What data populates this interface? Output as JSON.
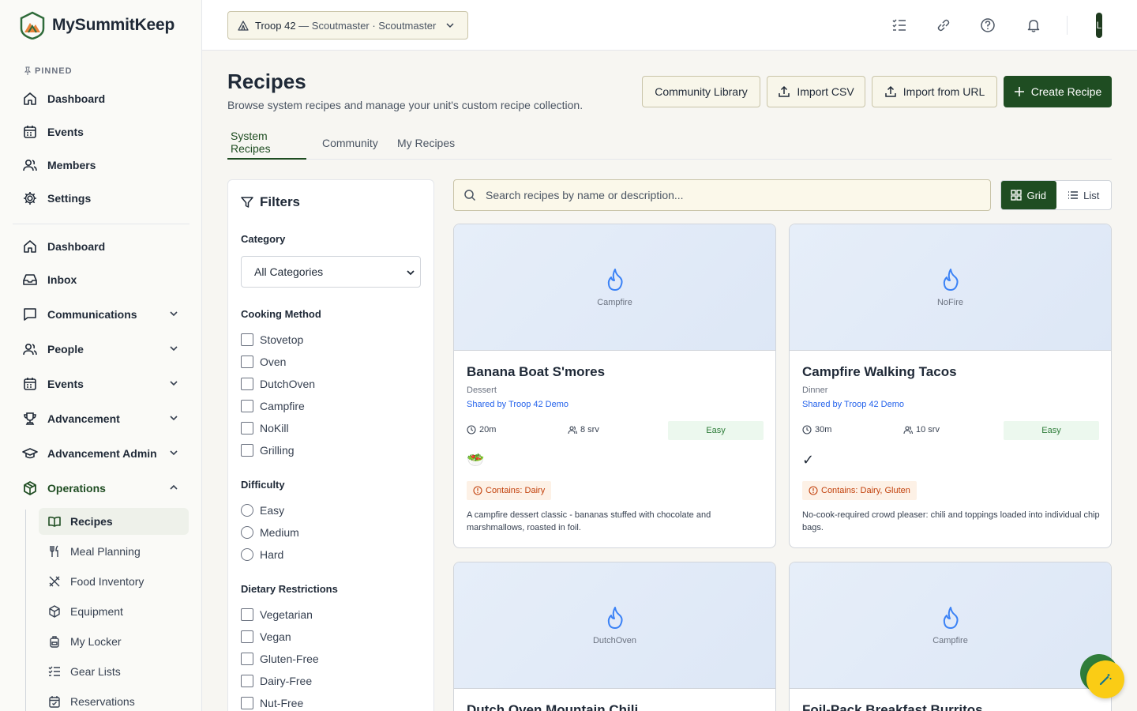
{
  "app": {
    "name": "MySummitKeep"
  },
  "sidebar": {
    "pinned_label": "PINNED",
    "pinned": [
      {
        "label": "Dashboard",
        "icon": "home-icon"
      },
      {
        "label": "Events",
        "icon": "calendar-icon"
      },
      {
        "label": "Members",
        "icon": "users-icon"
      },
      {
        "label": "Settings",
        "icon": "gear-icon"
      }
    ],
    "main": [
      {
        "label": "Dashboard",
        "icon": "home-icon"
      },
      {
        "label": "Inbox",
        "icon": "inbox-icon"
      },
      {
        "label": "Communications",
        "icon": "message-icon"
      },
      {
        "label": "People",
        "icon": "users-icon"
      },
      {
        "label": "Events",
        "icon": "calendar-icon"
      },
      {
        "label": "Advancement",
        "icon": "trophy-icon"
      },
      {
        "label": "Advancement Admin",
        "icon": "graduation-cap-icon"
      },
      {
        "label": "Operations",
        "icon": "box-icon"
      }
    ],
    "operations_sub": [
      {
        "label": "Recipes",
        "icon": "book-open-icon"
      },
      {
        "label": "Meal Planning",
        "icon": "utensils-icon"
      },
      {
        "label": "Food Inventory",
        "icon": "utensils-crossed-icon"
      },
      {
        "label": "Equipment",
        "icon": "package-icon"
      },
      {
        "label": "My Locker",
        "icon": "backpack-icon"
      },
      {
        "label": "Gear Lists",
        "icon": "checklist-icon"
      },
      {
        "label": "Reservations",
        "icon": "calendar-check-icon"
      }
    ]
  },
  "topbar": {
    "unit_name": "Troop 42",
    "unit_roles": " — Scoutmaster · Scoutmaster",
    "avatar_initial": "L"
  },
  "page": {
    "title": "Recipes",
    "subtitle": "Browse system recipes and manage your unit's custom recipe collection.",
    "buttons": {
      "community_library": "Community Library",
      "import_csv": "Import CSV",
      "import_url": "Import from URL",
      "create": "Create Recipe"
    },
    "tabs": [
      "System Recipes",
      "Community",
      "My Recipes"
    ]
  },
  "filters": {
    "title": "Filters",
    "category_label": "Category",
    "category_value": "All Categories",
    "cooking_label": "Cooking Method",
    "cooking_options": [
      "Stovetop",
      "Oven",
      "DutchOven",
      "Campfire",
      "NoKill",
      "Grilling"
    ],
    "difficulty_label": "Difficulty",
    "difficulty_options": [
      "Easy",
      "Medium",
      "Hard"
    ],
    "dietary_label": "Dietary Restrictions",
    "dietary_options": [
      "Vegetarian",
      "Vegan",
      "Gluten-Free",
      "Dairy-Free",
      "Nut-Free"
    ]
  },
  "search": {
    "placeholder": "Search recipes by name or description..."
  },
  "view_toggle": {
    "grid": "Grid",
    "list": "List"
  },
  "recipes": [
    {
      "method": "Campfire",
      "title": "Banana Boat S'mores",
      "category": "Dessert",
      "shared": "Shared by Troop 42 Demo",
      "time": "20m",
      "servings": "8 srv",
      "difficulty": "Easy",
      "emoji": "🥗",
      "allergens": "Contains: Dairy",
      "description": "A campfire dessert classic - bananas stuffed with chocolate and marshmallows, roasted in foil."
    },
    {
      "method": "NoFire",
      "title": "Campfire Walking Tacos",
      "category": "Dinner",
      "shared": "Shared by Troop 42 Demo",
      "time": "30m",
      "servings": "10 srv",
      "difficulty": "Easy",
      "emoji": "✓",
      "allergens": "Contains: Dairy, Gluten",
      "description": "No-cook-required crowd pleaser: chili and toppings loaded into individual chip bags."
    },
    {
      "method": "DutchOven",
      "title": "Dutch Oven Mountain Chili"
    },
    {
      "method": "Campfire",
      "title": "Foil-Pack Breakfast Burritos"
    }
  ],
  "colors": {
    "brand": "#1f4d22",
    "accent_yellow": "#facc15",
    "link": "#2563eb"
  }
}
